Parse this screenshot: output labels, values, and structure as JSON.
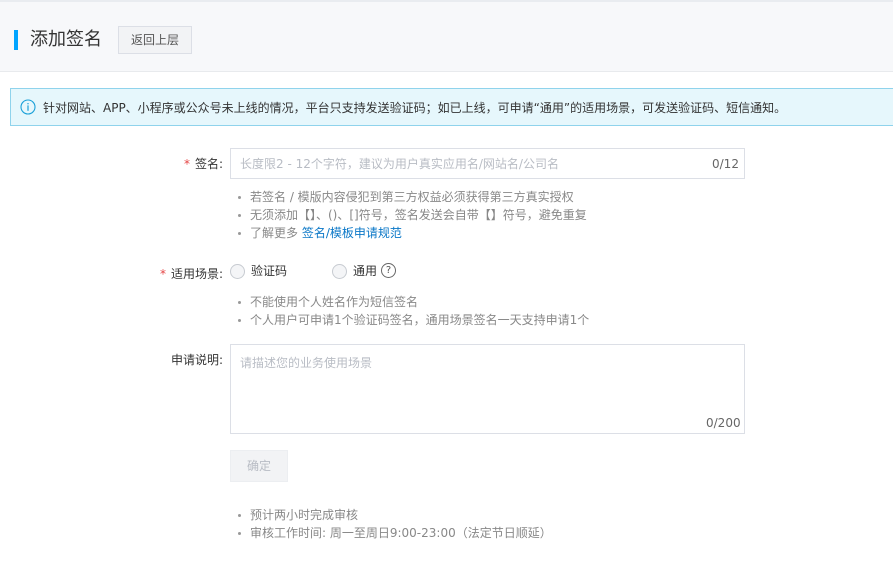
{
  "header": {
    "title": "添加签名",
    "back_label": "返回上层"
  },
  "notice": {
    "icon": "info-icon",
    "text": "针对网站、APP、小程序或公众号未上线的情况，平台只支持发送验证码；如已上线，可申请“通用”的适用场景，可发送验证码、短信通知。"
  },
  "form": {
    "signature": {
      "required_mark": "*",
      "label": "签名:",
      "placeholder": "长度限2 - 12个字符，建议为用户真实应用名/网站名/公司名",
      "value": "",
      "counter": "0/12",
      "tips": [
        "若签名 / 模版内容侵犯到第三方权益必须获得第三方真实授权",
        "无须添加【】、()、[]符号，签名发送会自带【】符号，避免重复"
      ],
      "learn_more_prefix": "了解更多",
      "learn_more_link": "签名/模板申请规范"
    },
    "scene": {
      "required_mark": "*",
      "label": "适用场景:",
      "options": [
        "验证码",
        "通用"
      ],
      "selected": "",
      "help_icon": "question-circle-icon",
      "help_glyph": "?",
      "tips": [
        "不能使用个人姓名作为短信签名",
        "个人用户可申请1个验证码签名，通用场景签名一天支持申请1个"
      ]
    },
    "description": {
      "label": "申请说明:",
      "placeholder": "请描述您的业务使用场景",
      "value": "",
      "counter": "0/200"
    },
    "confirm_label": "确定",
    "footer_tips": [
      "预计两小时完成审核",
      "审核工作时间: 周一至周日9:00-23:00（法定节日顺延）"
    ]
  }
}
